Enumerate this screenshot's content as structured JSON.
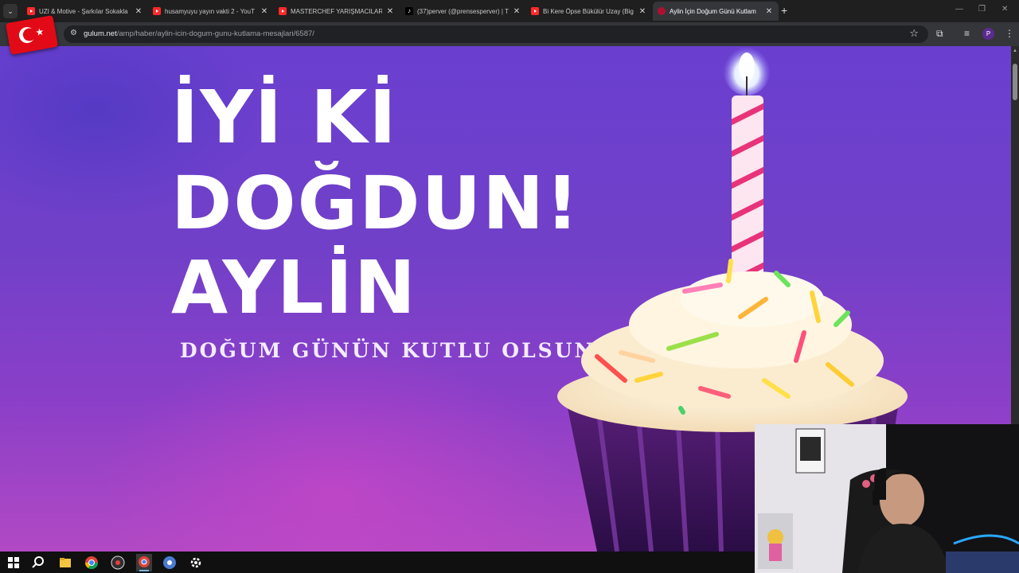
{
  "browser": {
    "tabs": [
      {
        "title": "UZI & Motive - Şarkılar Sokakla",
        "favicon": "youtube-icon",
        "active": false
      },
      {
        "title": "husamyuyu yayın vakti 2 - YouT",
        "favicon": "youtube-icon",
        "active": false
      },
      {
        "title": "MASTERCHEF YARIŞMACILARINI",
        "favicon": "youtube-icon",
        "active": false
      },
      {
        "title": "(37)perver (@prensesperver) | T",
        "favicon": "tiktok-icon",
        "active": false
      },
      {
        "title": "Bi Kere Öpse Bükülür Uzay (Big",
        "favicon": "youtube-icon",
        "active": false
      },
      {
        "title": "Aylin İçin Doğum Günü Kutlam",
        "favicon": "site-icon",
        "active": true
      }
    ],
    "new_tab": "+",
    "close_glyph": "✕",
    "url_domain": "gulum.net",
    "url_path": "/amp/haber/aylin-icin-dogum-gunu-kutlama-mesajlari/6587/",
    "profile_initial": "P"
  },
  "page": {
    "line1": "İYİ Kİ",
    "line2": "DOĞDUN!",
    "line3": "AYLİN",
    "subtitle": "DOĞUM GÜNÜN KUTLU OLSUN"
  },
  "colors": {
    "accent": "#7140c8",
    "candle_stripe": "#e8337a",
    "flag_red": "#e30a17"
  }
}
